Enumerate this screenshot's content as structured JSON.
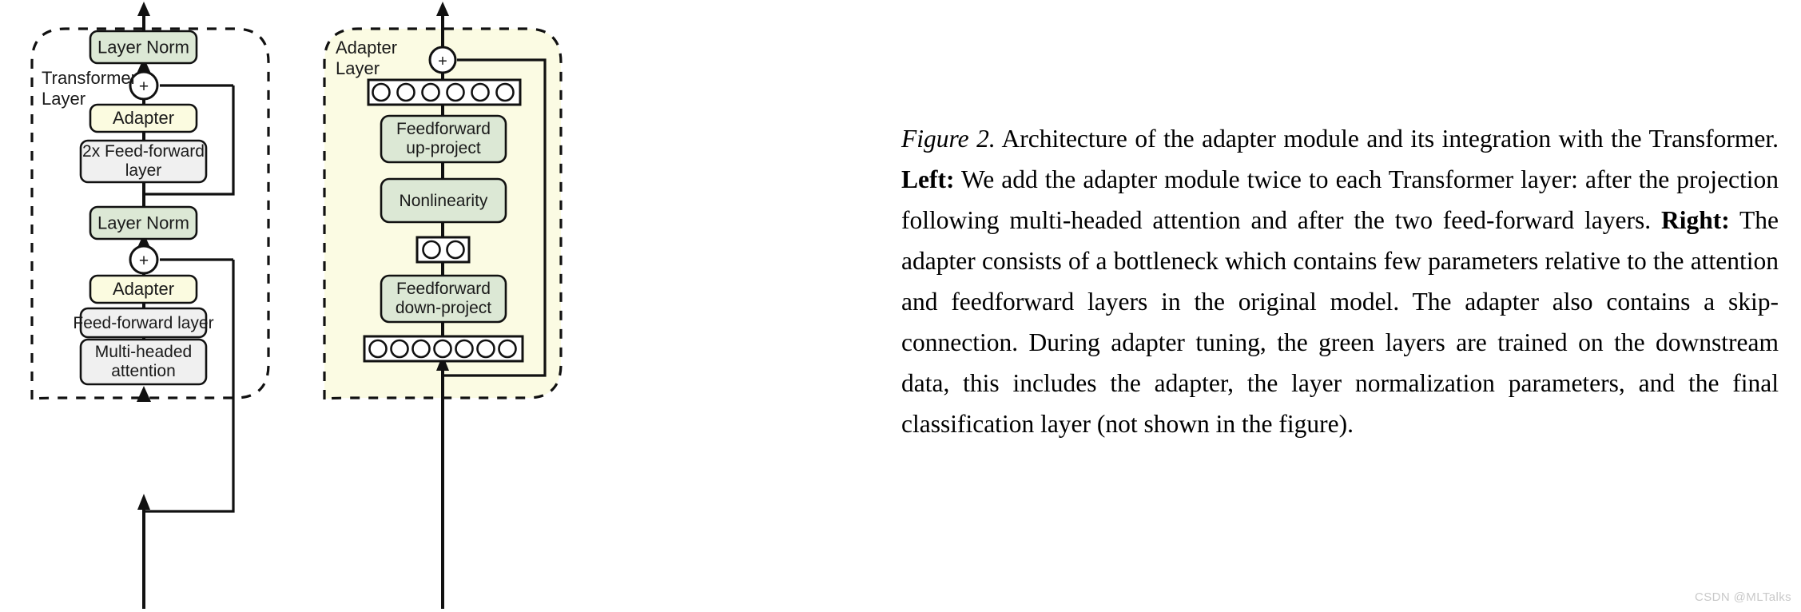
{
  "figure": {
    "left_panel": {
      "panel_label": "Transformer\nLayer",
      "panel_label_line1": "Transformer",
      "panel_label_line2": "Layer",
      "blocks": [
        {
          "id": "layer-norm-top",
          "label": "Layer Norm",
          "color": "#dce8d5",
          "kind": "green"
        },
        {
          "id": "add-top",
          "label": "+",
          "kind": "adder"
        },
        {
          "id": "adapter-top",
          "label": "Adapter",
          "color": "#fbfbe0",
          "kind": "cream"
        },
        {
          "id": "ff2x",
          "label": "2x Feed-forward\nlayer",
          "label_line1": "2x Feed-forward",
          "label_line2": "layer",
          "color": "#f0f0f0",
          "kind": "grey"
        },
        {
          "id": "layer-norm-bottom",
          "label": "Layer Norm",
          "color": "#dce8d5",
          "kind": "green"
        },
        {
          "id": "add-bottom",
          "label": "+",
          "kind": "adder"
        },
        {
          "id": "adapter-bottom",
          "label": "Adapter",
          "color": "#fbfbe0",
          "kind": "cream"
        },
        {
          "id": "feed-forward",
          "label": "Feed-forward layer",
          "color": "#f0f0f0",
          "kind": "grey"
        },
        {
          "id": "multi-head",
          "label": "Multi-headed\nattention",
          "label_line1": "Multi-headed",
          "label_line2": "attention",
          "color": "#f0f0f0",
          "kind": "grey"
        }
      ]
    },
    "right_panel": {
      "panel_label_line1": "Adapter",
      "panel_label_line2": "Layer",
      "panel_fill": "#fbfbe3",
      "adder_label": "+",
      "top_neurons": 6,
      "bottleneck_neurons": 2,
      "bottom_neurons": 7,
      "blocks": [
        {
          "id": "ff-up",
          "label_line1": "Feedforward",
          "label_line2": "up-project",
          "color": "#dce8d5"
        },
        {
          "id": "nonlinearity",
          "label_line1": "Nonlinearity",
          "label_line2": "",
          "color": "#dce8d5"
        },
        {
          "id": "ff-down",
          "label_line1": "Feedforward",
          "label_line2": "down-project",
          "color": "#dce8d5"
        }
      ]
    }
  },
  "caption": {
    "figure_label": "Figure 2.",
    "text_part_1": " Architecture of the adapter module and its integration with the Transformer. ",
    "bold_left": "Left:",
    "text_part_2": " We add the adapter module twice to each Transformer layer: after the projection following multi-headed attention and after the two feed-forward layers. ",
    "bold_right": "Right:",
    "text_part_3": " The adapter consists of a bottleneck which contains few parameters relative to the attention and feedforward layers in the original model. The adapter also contains a skip-connection. During adapter tuning, the green layers are trained on the downstream data, this includes the adapter, the layer normalization parameters, and the final classification layer (not shown in the figure)."
  },
  "watermark": {
    "text": "CSDN @MLTalks"
  },
  "colors": {
    "green_block": "#dce8d5",
    "cream_block": "#fbfbe0",
    "grey_block": "#f0f0f0",
    "panel_fill": "#fbfbe3",
    "stroke": "#000000",
    "watermark": "#c9c9c9"
  }
}
